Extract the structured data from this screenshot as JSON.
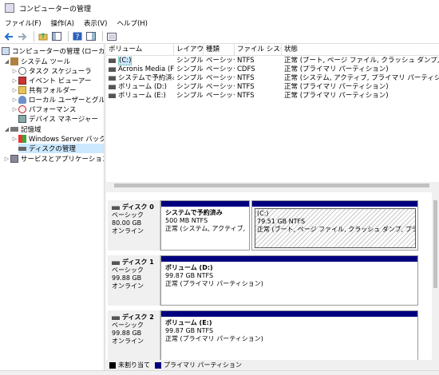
{
  "window": {
    "title": "コンピューターの管理"
  },
  "menu": [
    "ファイル(F)",
    "操作(A)",
    "表示(V)",
    "ヘルプ(H)"
  ],
  "toolbar": [
    "back-icon",
    "forward-icon",
    "folder-up-icon",
    "show-tree-icon",
    "help-icon",
    "properties-icon",
    "view-icon"
  ],
  "tree": {
    "root": "コンピューターの管理 (ローカル)",
    "system_tools": "システム ツール",
    "task_scheduler": "タスク スケジューラ",
    "event_viewer": "イベント ビューアー",
    "shared_folders": "共有フォルダー",
    "local_users": "ローカル ユーザーとグループ",
    "performance": "パフォーマンス",
    "device_manager": "デバイス マネージャー",
    "storage": "記憶域",
    "windows_backup": "Windows Server バックアップ",
    "disk_management": "ディスクの管理",
    "services_apps": "サービスとアプリケーション"
  },
  "volumes": {
    "headers": [
      "ボリューム",
      "レイアウト",
      "種類",
      "ファイル システム",
      "状態"
    ],
    "rows": [
      [
        "(C:)",
        "シンプル",
        "ベーシック",
        "NTFS",
        "正常 (ブート, ページ ファイル, クラッシュ ダンプ, プライマリ パー"
      ],
      [
        "Acronis Media (F:)",
        "シンプル",
        "ベーシック",
        "CDFS",
        "正常 (プライマリ パーティション)"
      ],
      [
        "システムで予約済み",
        "シンプル",
        "ベーシック",
        "NTFS",
        "正常 (システム, アクティブ, プライマリ パーティション)"
      ],
      [
        "ボリューム (D:)",
        "シンプル",
        "ベーシック",
        "NTFS",
        "正常 (プライマリ パーティション)"
      ],
      [
        "ボリューム (E:)",
        "シンプル",
        "ベーシック",
        "NTFS",
        "正常 (プライマリ パーティション)"
      ]
    ]
  },
  "disks": [
    {
      "name": "ディスク 0",
      "type": "ベーシック",
      "size": "80.00 GB",
      "status": "オンライン",
      "partitions": [
        {
          "label": "システムで予約済み",
          "size": "500 MB NTFS",
          "status": "正常 (システム, アクティブ, プライマ"
        },
        {
          "label": "(C:)",
          "size": "79.51 GB NTFS",
          "status": "正常 (ブート, ページ ファイル, クラッシュ ダンプ, プライマリ パーテ"
        }
      ]
    },
    {
      "name": "ディスク 1",
      "type": "ベーシック",
      "size": "99.88 GB",
      "status": "オンライン",
      "partitions": [
        {
          "label": "ボリューム (D:)",
          "size": "99.87 GB NTFS",
          "status": "正常 (プライマリ パーティション)"
        }
      ]
    },
    {
      "name": "ディスク 2",
      "type": "ベーシック",
      "size": "99.88 GB",
      "status": "オンライン",
      "partitions": [
        {
          "label": "ボリューム (E:)",
          "size": "99.87 GB NTFS",
          "status": "正常 (プライマリ パーティション)"
        }
      ]
    }
  ],
  "legend": {
    "unallocated": "未割り当て",
    "primary": "プライマリ パーティション",
    "unallocated_color": "#000000",
    "primary_color": "#00007f"
  }
}
